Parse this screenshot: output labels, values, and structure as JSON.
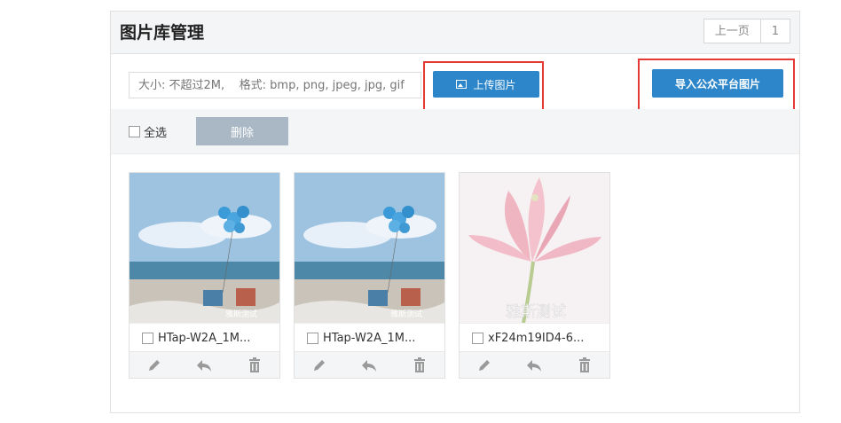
{
  "header": {
    "title": "图片库管理",
    "pager": {
      "prev_label": "上一页",
      "page_number": "1"
    }
  },
  "upload": {
    "hint": "大小: 不超过2M,    格式: bmp, png, jpeg, jpg, gif",
    "upload_label": "上传图片",
    "import_label": "导入公众平台图片"
  },
  "actions": {
    "select_all_label": "全选",
    "delete_label": "删除"
  },
  "images": [
    {
      "name": "HTap-W2A_1M...",
      "watermark": "雅斯测试",
      "kind": "beach"
    },
    {
      "name": "HTap-W2A_1M...",
      "watermark": "雅斯测试",
      "kind": "beach"
    },
    {
      "name": "xF24m19ID4-6...",
      "watermark": "雅斯测试",
      "kind": "lotus"
    }
  ],
  "colors": {
    "accent": "#2c86c9",
    "highlight": "#e53935",
    "delete_disabled": "#a9b8c4"
  },
  "icons": [
    "image-icon",
    "edit-icon",
    "reply-icon",
    "trash-icon",
    "checkbox-icon"
  ]
}
